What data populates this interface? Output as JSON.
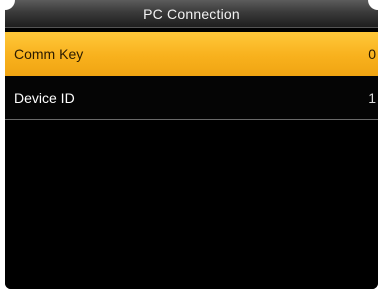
{
  "header": {
    "title": "PC Connection"
  },
  "menu": {
    "items": [
      {
        "label": "Comm Key",
        "value": "0",
        "selected": true
      },
      {
        "label": "Device ID",
        "value": "1",
        "selected": false
      }
    ]
  },
  "colors": {
    "highlight": "#f8b11d",
    "background": "#000000",
    "title_bar": "#3a3a3a"
  }
}
